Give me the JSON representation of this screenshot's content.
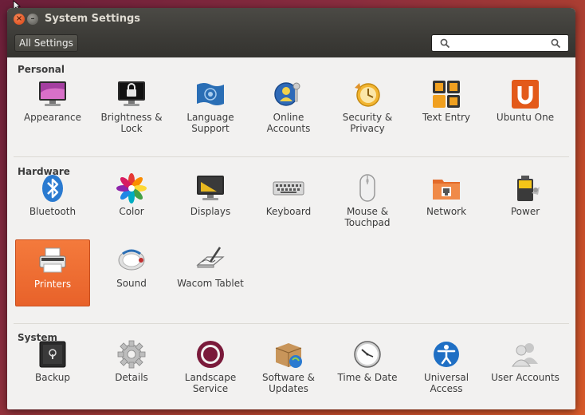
{
  "window": {
    "title": "System Settings",
    "all_settings_label": "All Settings",
    "search_placeholder": ""
  },
  "sections": [
    {
      "title": "Personal",
      "items": [
        {
          "label": "Appearance",
          "icon": "appearance-icon"
        },
        {
          "label": "Brightness & Lock",
          "icon": "brightness-lock-icon"
        },
        {
          "label": "Language Support",
          "icon": "language-support-icon"
        },
        {
          "label": "Online Accounts",
          "icon": "online-accounts-icon"
        },
        {
          "label": "Security & Privacy",
          "icon": "security-privacy-icon"
        },
        {
          "label": "Text Entry",
          "icon": "text-entry-icon"
        },
        {
          "label": "Ubuntu One",
          "icon": "ubuntu-one-icon"
        }
      ]
    },
    {
      "title": "Hardware",
      "items": [
        {
          "label": "Bluetooth",
          "icon": "bluetooth-icon"
        },
        {
          "label": "Color",
          "icon": "color-icon"
        },
        {
          "label": "Displays",
          "icon": "displays-icon"
        },
        {
          "label": "Keyboard",
          "icon": "keyboard-icon"
        },
        {
          "label": "Mouse & Touchpad",
          "icon": "mouse-icon"
        },
        {
          "label": "Network",
          "icon": "network-icon"
        },
        {
          "label": "Power",
          "icon": "power-icon"
        },
        {
          "label": "Printers",
          "icon": "printer-icon",
          "selected": true
        },
        {
          "label": "Sound",
          "icon": "sound-icon"
        },
        {
          "label": "Wacom Tablet",
          "icon": "wacom-tablet-icon"
        }
      ]
    },
    {
      "title": "System",
      "items": [
        {
          "label": "Backup",
          "icon": "backup-icon"
        },
        {
          "label": "Details",
          "icon": "details-icon"
        },
        {
          "label": "Landscape Service",
          "icon": "landscape-icon"
        },
        {
          "label": "Software & Updates",
          "icon": "software-updates-icon"
        },
        {
          "label": "Time & Date",
          "icon": "time-date-icon"
        },
        {
          "label": "Universal Access",
          "icon": "universal-access-icon"
        },
        {
          "label": "User Accounts",
          "icon": "user-accounts-icon"
        }
      ]
    }
  ],
  "colors": {
    "accent": "#e8622a",
    "titlebar": "#3c3b37",
    "background": "#f2f1f0"
  }
}
